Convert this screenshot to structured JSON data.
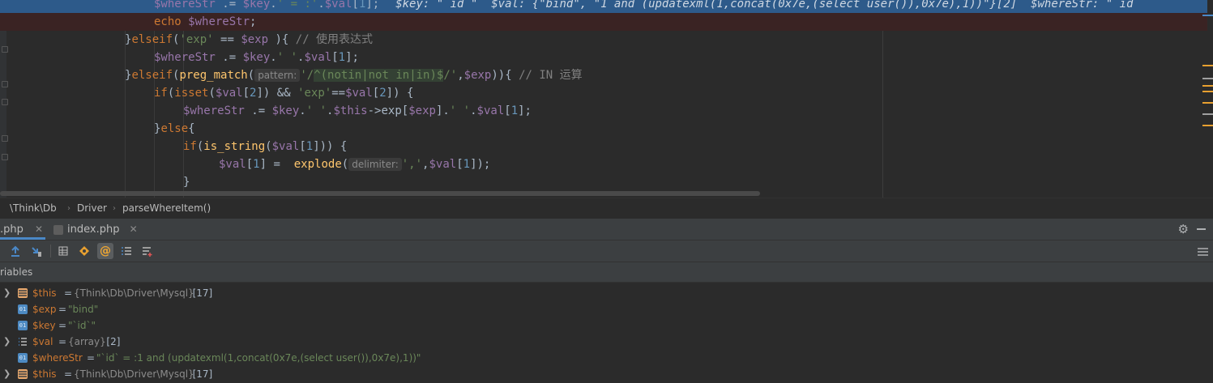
{
  "editor": {
    "lines": [
      {
        "kind": "exec",
        "tokens": [
          {
            "t": "$whereStr",
            "c": "var"
          },
          {
            "t": " .= ",
            "c": "op"
          },
          {
            "t": "$key",
            "c": "var"
          },
          {
            "t": ".",
            "c": "op"
          },
          {
            "t": "' = :'",
            "c": "str"
          },
          {
            "t": ".",
            "c": "op"
          },
          {
            "t": "$val",
            "c": "var"
          },
          {
            "t": "[",
            "c": "op"
          },
          {
            "t": "1",
            "c": "num"
          },
          {
            "t": "];",
            "c": "op"
          }
        ],
        "inline_debug": "$key: \"`id`\"  $val: {\"bind\", \"1 and (updatexml(1,concat(0x7e,(select user()),0x7e),1))\"}[2]  $whereStr: \"`id`"
      },
      {
        "kind": "bp",
        "tokens": [
          {
            "t": "echo ",
            "c": "kw"
          },
          {
            "t": "$whereStr",
            "c": "var"
          },
          {
            "t": ";",
            "c": "op"
          }
        ]
      },
      {
        "kind": "normal",
        "tokens": [
          {
            "t": "}",
            "c": "op"
          },
          {
            "t": "elseif",
            "c": "kw"
          },
          {
            "t": "(",
            "c": "op"
          },
          {
            "t": "'exp'",
            "c": "str"
          },
          {
            "t": " == ",
            "c": "op"
          },
          {
            "t": "$exp",
            "c": "var"
          },
          {
            "t": " ){ ",
            "c": "op"
          },
          {
            "t": "// 使用表达式",
            "c": "cm"
          }
        ]
      },
      {
        "kind": "normal",
        "tokens": [
          {
            "t": "$whereStr",
            "c": "var"
          },
          {
            "t": " .= ",
            "c": "op"
          },
          {
            "t": "$key",
            "c": "var"
          },
          {
            "t": ".",
            "c": "op"
          },
          {
            "t": "' '",
            "c": "str"
          },
          {
            "t": ".",
            "c": "op"
          },
          {
            "t": "$val",
            "c": "var"
          },
          {
            "t": "[",
            "c": "op"
          },
          {
            "t": "1",
            "c": "num"
          },
          {
            "t": "];",
            "c": "op"
          }
        ]
      },
      {
        "kind": "normal",
        "tokens": [
          {
            "t": "}",
            "c": "op"
          },
          {
            "t": "elseif",
            "c": "kw"
          },
          {
            "t": "(",
            "c": "op"
          },
          {
            "t": "preg_match",
            "c": "fn"
          },
          {
            "t": "(",
            "c": "op"
          },
          {
            "t": "pattern:",
            "c": "hint"
          },
          {
            "t": "'/",
            "c": "str"
          },
          {
            "t": "^(notin|not in|in)$",
            "c": "regex"
          },
          {
            "t": "/'",
            "c": "str"
          },
          {
            "t": ",",
            "c": "op"
          },
          {
            "t": "$exp",
            "c": "var"
          },
          {
            "t": ")){ ",
            "c": "op"
          },
          {
            "t": "// IN 运算",
            "c": "cm"
          }
        ]
      },
      {
        "kind": "normal",
        "tokens": [
          {
            "t": "if",
            "c": "kw"
          },
          {
            "t": "(",
            "c": "op"
          },
          {
            "t": "isset",
            "c": "kw"
          },
          {
            "t": "(",
            "c": "op"
          },
          {
            "t": "$val",
            "c": "var"
          },
          {
            "t": "[",
            "c": "op"
          },
          {
            "t": "2",
            "c": "num"
          },
          {
            "t": "]) && ",
            "c": "op"
          },
          {
            "t": "'exp'",
            "c": "str"
          },
          {
            "t": "==",
            "c": "op"
          },
          {
            "t": "$val",
            "c": "var"
          },
          {
            "t": "[",
            "c": "op"
          },
          {
            "t": "2",
            "c": "num"
          },
          {
            "t": "]) {",
            "c": "op"
          }
        ]
      },
      {
        "kind": "normal",
        "tokens": [
          {
            "t": "$whereStr",
            "c": "var"
          },
          {
            "t": " .= ",
            "c": "op"
          },
          {
            "t": "$key",
            "c": "var"
          },
          {
            "t": ".",
            "c": "op"
          },
          {
            "t": "' '",
            "c": "str"
          },
          {
            "t": ".",
            "c": "op"
          },
          {
            "t": "$this",
            "c": "var"
          },
          {
            "t": "->",
            "c": "op"
          },
          {
            "t": "exp",
            "c": "op"
          },
          {
            "t": "[",
            "c": "op"
          },
          {
            "t": "$exp",
            "c": "var"
          },
          {
            "t": "].",
            "c": "op"
          },
          {
            "t": "' '",
            "c": "str"
          },
          {
            "t": ".",
            "c": "op"
          },
          {
            "t": "$val",
            "c": "var"
          },
          {
            "t": "[",
            "c": "op"
          },
          {
            "t": "1",
            "c": "num"
          },
          {
            "t": "];",
            "c": "op"
          }
        ]
      },
      {
        "kind": "normal",
        "tokens": [
          {
            "t": "}",
            "c": "op"
          },
          {
            "t": "else",
            "c": "kw"
          },
          {
            "t": "{",
            "c": "op"
          }
        ]
      },
      {
        "kind": "normal",
        "tokens": [
          {
            "t": "if",
            "c": "kw"
          },
          {
            "t": "(",
            "c": "op"
          },
          {
            "t": "is_string",
            "c": "fn"
          },
          {
            "t": "(",
            "c": "op"
          },
          {
            "t": "$val",
            "c": "var"
          },
          {
            "t": "[",
            "c": "op"
          },
          {
            "t": "1",
            "c": "num"
          },
          {
            "t": "])) {",
            "c": "op"
          }
        ]
      },
      {
        "kind": "normal",
        "tokens": [
          {
            "t": "$val",
            "c": "var"
          },
          {
            "t": "[",
            "c": "op"
          },
          {
            "t": "1",
            "c": "num"
          },
          {
            "t": "] =  ",
            "c": "op"
          },
          {
            "t": "explode",
            "c": "fn"
          },
          {
            "t": "(",
            "c": "op"
          },
          {
            "t": "delimiter:",
            "c": "hint"
          },
          {
            "t": "','",
            "c": "str"
          },
          {
            "t": ",",
            "c": "op"
          },
          {
            "t": "$val",
            "c": "var"
          },
          {
            "t": "[",
            "c": "op"
          },
          {
            "t": "1",
            "c": "num"
          },
          {
            "t": "]);",
            "c": "op"
          }
        ]
      },
      {
        "kind": "normal",
        "tokens": [
          {
            "t": "}",
            "c": "op"
          }
        ]
      }
    ]
  },
  "breadcrumb": {
    "part1": "\\Think\\Db",
    "part2": "Driver",
    "part3": "parseWhereItem()"
  },
  "debug_tabs": {
    "tab1": ".php",
    "tab2": "index.php"
  },
  "variables": {
    "header": "riables",
    "rows": [
      {
        "name": "$this",
        "value": "{Think\\Db\\Driver\\Mysql}",
        "count": "[17]",
        "icon": "object-icon",
        "expandable": true,
        "value_style": "type"
      },
      {
        "name": "$exp",
        "value": "\"bind\"",
        "count": "",
        "icon": "primitive-icon",
        "expandable": false,
        "value_style": "string"
      },
      {
        "name": "$key",
        "value": "\"`id`\"",
        "count": "",
        "icon": "primitive-icon",
        "expandable": false,
        "value_style": "string"
      },
      {
        "name": "$val",
        "value": "{array}",
        "count": "[2]",
        "icon": "array-icon",
        "expandable": true,
        "value_style": "type"
      },
      {
        "name": "$whereStr",
        "value": "\"`id` = :1 and (updatexml(1,concat(0x7e,(select user()),0x7e),1))\"",
        "count": "",
        "icon": "primitive-icon",
        "expandable": false,
        "value_style": "string"
      },
      {
        "name": "$this",
        "value": "{Think\\Db\\Driver\\Mysql}",
        "count": "[17]",
        "icon": "object-icon",
        "expandable": true,
        "value_style": "type"
      }
    ]
  }
}
